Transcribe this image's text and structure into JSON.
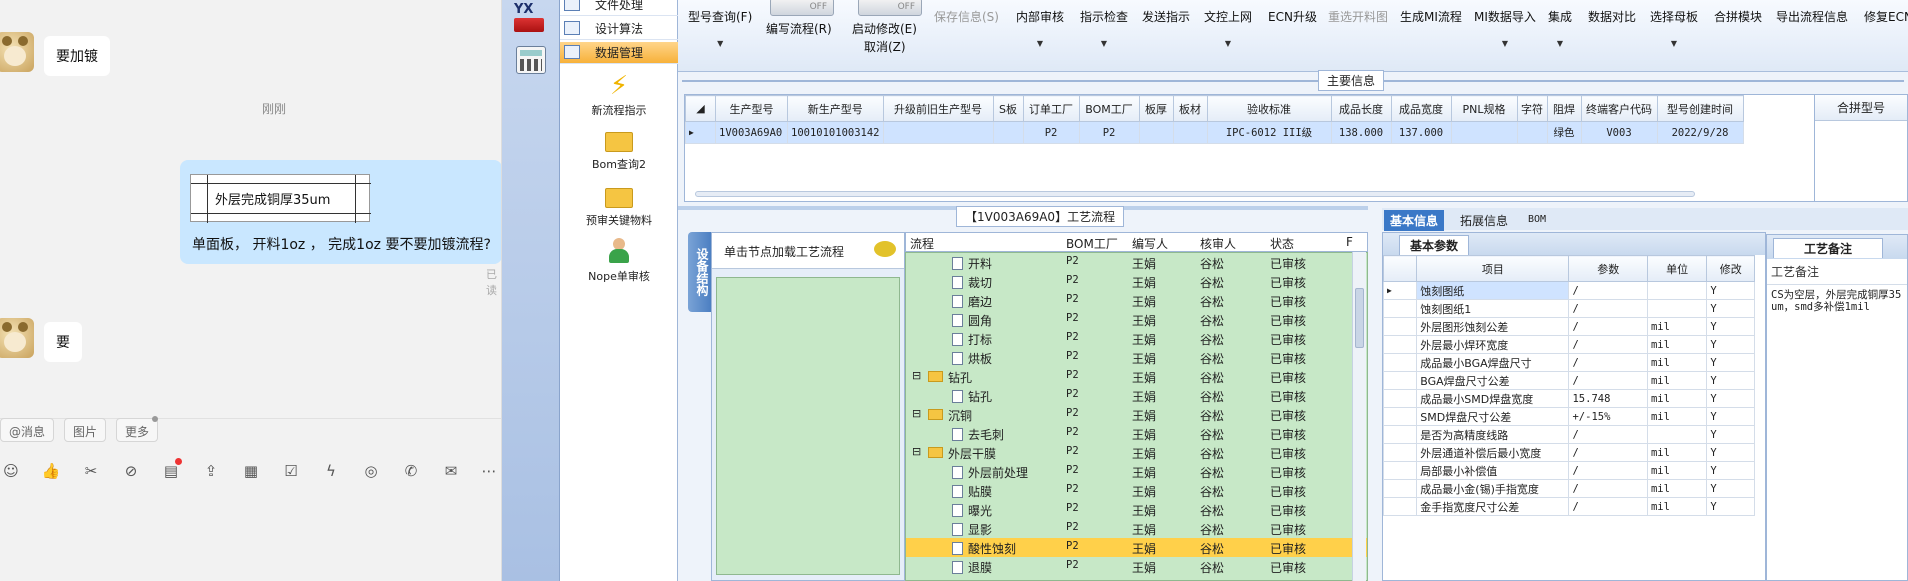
{
  "chat": {
    "messages": [
      {
        "side": "left",
        "text": "要加镀"
      },
      {
        "side": "center",
        "text": "刚刚"
      },
      {
        "side": "right",
        "image_caption": "外层完成铜厚35um",
        "text": "单面板， 开料1oz ， 完成1oz 要不要加镀流程?",
        "status": "已读"
      },
      {
        "side": "left",
        "text": "要"
      }
    ],
    "chips": [
      "@消息",
      "图片",
      "更多"
    ],
    "toolbar_icons": [
      "emoji-icon",
      "thumbs-up-icon",
      "scissors-icon",
      "format-icon",
      "add-doc-icon",
      "upload-icon",
      "calendar-icon",
      "check-icon",
      "lightning-icon",
      "voice-icon",
      "phone-icon",
      "mail-icon",
      "more-icon"
    ]
  },
  "nav": {
    "logo_text": "YX",
    "rows": [
      {
        "label": "文件处理",
        "active": false
      },
      {
        "label": "设计算法",
        "active": false
      },
      {
        "label": "数据管理",
        "active": true
      }
    ],
    "items": [
      "新流程指示",
      "Bom查询2",
      "预审关键物料",
      "Nope单审核"
    ]
  },
  "ribbon": {
    "buttons": [
      {
        "label": "型号查询(F)",
        "arrow": true,
        "disabled": false
      },
      {
        "label": "编写流程(R)",
        "arrow": false,
        "disabled": false,
        "toggle": "OFF"
      },
      {
        "label": "启动修改(E)",
        "arrow": false,
        "disabled": false,
        "toggle": "OFF"
      },
      {
        "label": "取消(Z)",
        "arrow": false,
        "disabled": false
      },
      {
        "label": "保存信息(S)",
        "arrow": false,
        "disabled": true
      },
      {
        "label": "内部审核",
        "arrow": true,
        "disabled": false
      },
      {
        "label": "指示检查",
        "arrow": true,
        "disabled": false
      },
      {
        "label": "发送指示",
        "arrow": false,
        "disabled": false
      },
      {
        "label": "文控上网",
        "arrow": true,
        "disabled": false
      },
      {
        "label": "ECN升级",
        "arrow": false,
        "disabled": false
      },
      {
        "label": "重选开料图",
        "arrow": false,
        "disabled": true
      },
      {
        "label": "生成MI流程",
        "arrow": false,
        "disabled": false
      },
      {
        "label": "MI数据导入",
        "arrow": true,
        "disabled": false
      },
      {
        "label": "集成",
        "arrow": true,
        "disabled": false
      },
      {
        "label": "数据对比",
        "arrow": false,
        "disabled": false
      },
      {
        "label": "选择母板",
        "arrow": true,
        "disabled": false
      },
      {
        "label": "合拼模块",
        "arrow": false,
        "disabled": false
      },
      {
        "label": "导出流程信息",
        "arrow": false,
        "disabled": false
      },
      {
        "label": "修复ECN",
        "arrow": false,
        "disabled": false
      }
    ]
  },
  "main_info": {
    "title": "主要信息",
    "columns": [
      "生产型号",
      "新生产型号",
      "升级前旧生产型号",
      "S板",
      "订单工厂",
      "BOM工厂",
      "板厚",
      "板材",
      "验收标准",
      "成品长度",
      "成品宽度",
      "PNL规格",
      "字符",
      "阻焊",
      "终端客户代码",
      "型号创建时间"
    ],
    "rows": [
      [
        "1V003A69A0",
        "10010101003142",
        "",
        "",
        "P2",
        "P2",
        "",
        "",
        "IPC-6012 III级",
        "138.000",
        "137.000",
        "",
        "",
        "绿色",
        "V003",
        "2022/9/28"
      ]
    ],
    "merge_header": "合拼型号"
  },
  "process": {
    "title": "【1V003A69A0】工艺流程",
    "left_tab": "设备结构",
    "left_header": "单击节点加载工艺流程",
    "columns": [
      "流程",
      "BOM工厂",
      "编写人",
      "核审人",
      "状态",
      "F"
    ],
    "rows": [
      {
        "name": "开料",
        "level": 2,
        "folder": false,
        "bom": "P2",
        "writer": "王娟",
        "reviewer": "谷松",
        "status": "已审核"
      },
      {
        "name": "裁切",
        "level": 2,
        "folder": false,
        "bom": "P2",
        "writer": "王娟",
        "reviewer": "谷松",
        "status": "已审核"
      },
      {
        "name": "磨边",
        "level": 2,
        "folder": false,
        "bom": "P2",
        "writer": "王娟",
        "reviewer": "谷松",
        "status": "已审核"
      },
      {
        "name": "圆角",
        "level": 2,
        "folder": false,
        "bom": "P2",
        "writer": "王娟",
        "reviewer": "谷松",
        "status": "已审核"
      },
      {
        "name": "打标",
        "level": 2,
        "folder": false,
        "bom": "P2",
        "writer": "王娟",
        "reviewer": "谷松",
        "status": "已审核"
      },
      {
        "name": "烘板",
        "level": 2,
        "folder": false,
        "bom": "P2",
        "writer": "王娟",
        "reviewer": "谷松",
        "status": "已审核"
      },
      {
        "name": "钻孔",
        "level": 1,
        "folder": true,
        "bom": "P2",
        "writer": "王娟",
        "reviewer": "谷松",
        "status": "已审核"
      },
      {
        "name": "钻孔",
        "level": 2,
        "folder": false,
        "bom": "P2",
        "writer": "王娟",
        "reviewer": "谷松",
        "status": "已审核"
      },
      {
        "name": "沉铜",
        "level": 1,
        "folder": true,
        "bom": "P2",
        "writer": "王娟",
        "reviewer": "谷松",
        "status": "已审核"
      },
      {
        "name": "去毛刺",
        "level": 2,
        "folder": false,
        "bom": "P2",
        "writer": "王娟",
        "reviewer": "谷松",
        "status": "已审核"
      },
      {
        "name": "外层干膜",
        "level": 1,
        "folder": true,
        "bom": "P2",
        "writer": "王娟",
        "reviewer": "谷松",
        "status": "已审核"
      },
      {
        "name": "外层前处理",
        "level": 2,
        "folder": false,
        "bom": "P2",
        "writer": "王娟",
        "reviewer": "谷松",
        "status": "已审核"
      },
      {
        "name": "贴膜",
        "level": 2,
        "folder": false,
        "bom": "P2",
        "writer": "王娟",
        "reviewer": "谷松",
        "status": "已审核"
      },
      {
        "name": "曝光",
        "level": 2,
        "folder": false,
        "bom": "P2",
        "writer": "王娟",
        "reviewer": "谷松",
        "status": "已审核"
      },
      {
        "name": "显影",
        "level": 2,
        "folder": false,
        "bom": "P2",
        "writer": "王娟",
        "reviewer": "谷松",
        "status": "已审核"
      },
      {
        "name": "酸性蚀刻",
        "level": 2,
        "folder": false,
        "bom": "P2",
        "writer": "王娟",
        "reviewer": "谷松",
        "status": "已审核",
        "highlight": true
      },
      {
        "name": "退膜",
        "level": 2,
        "folder": false,
        "bom": "P2",
        "writer": "王娟",
        "reviewer": "谷松",
        "status": "已审核"
      }
    ]
  },
  "params": {
    "tabs": [
      "基本信息",
      "拓展信息",
      "BOM"
    ],
    "active_tab": "基本信息",
    "subtab": "基本参数",
    "columns": [
      "项目",
      "参数",
      "单位",
      "修改"
    ],
    "rows": [
      [
        "蚀刻图纸",
        "/",
        "",
        "Y"
      ],
      [
        "蚀刻图纸1",
        "/",
        "",
        "Y"
      ],
      [
        "外层图形蚀刻公差",
        "/",
        "mil",
        "Y"
      ],
      [
        "外层最小焊环宽度",
        "/",
        "mil",
        "Y"
      ],
      [
        "成品最小BGA焊盘尺寸",
        "/",
        "mil",
        "Y"
      ],
      [
        "BGA焊盘尺寸公差",
        "/",
        "mil",
        "Y"
      ],
      [
        "成品最小SMD焊盘宽度",
        "15.748",
        "mil",
        "Y"
      ],
      [
        "SMD焊盘尺寸公差",
        "+/-15%",
        "mil",
        "Y"
      ],
      [
        "是否为高精度线路",
        "/",
        "",
        "Y"
      ],
      [
        "外层通道补偿后最小宽度",
        "/",
        "mil",
        "Y"
      ],
      [
        "局部最小补偿值",
        "/",
        "mil",
        "Y"
      ],
      [
        "成品最小金(锡)手指宽度",
        "/",
        "mil",
        "Y"
      ],
      [
        "金手指宽度尺寸公差",
        "/",
        "mil",
        "Y"
      ]
    ]
  },
  "remarks": {
    "title": "工艺备注",
    "label": "工艺备注",
    "text": "CS为空层，外层完成铜厚35um，smd多补偿1mil"
  }
}
